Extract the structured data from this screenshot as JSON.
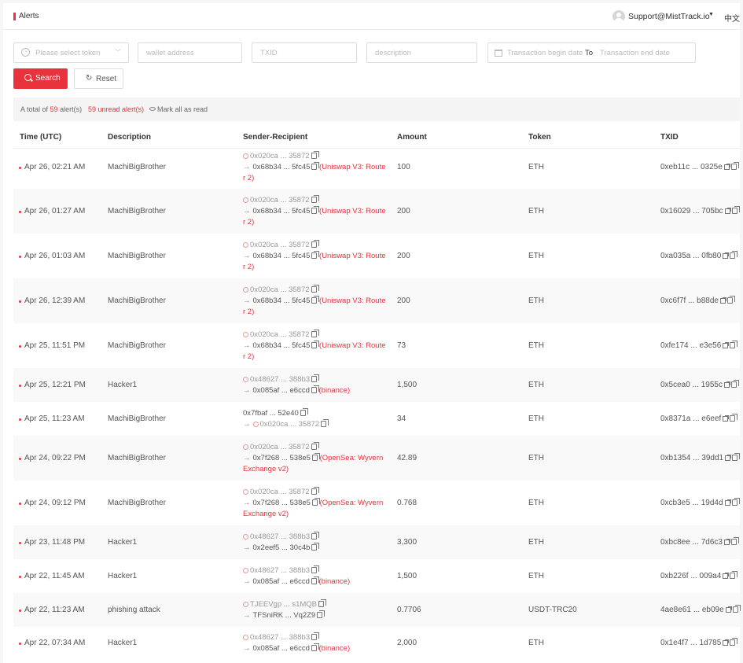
{
  "header": {
    "title": "Alerts",
    "user": "Support@MistTrack.io",
    "language": "中文"
  },
  "filters": {
    "token_placeholder": "Please select token",
    "wallet_placeholder": "wallet address",
    "txid_placeholder": "TXID",
    "description_placeholder": "description",
    "date_begin_placeholder": "Transaction begin date",
    "date_to": "To",
    "date_end_placeholder": "Transaction end date",
    "search_label": "Search",
    "reset_label": "Reset"
  },
  "summary": {
    "total_prefix": "A total of",
    "total_count": "59",
    "total_suffix": "alert(s)",
    "unread_count": "59",
    "unread_suffix": "unread alert(s)",
    "mark_all_label": "Mark all as read"
  },
  "table": {
    "columns": [
      "Time (UTC)",
      "Description",
      "Sender-Recipient",
      "Amount",
      "Token",
      "TXID"
    ],
    "rows": [
      {
        "time": "Apr 26, 02:21 AM",
        "description": "MachiBigBrother",
        "sender": "0x020ca ... 35872",
        "recipient": "0x68b34 ... 5fc45",
        "label_1": "(Uniswap V3: Route",
        "label_2": "r 2)",
        "amount": "100",
        "token": "ETH",
        "txid": "0xeb11c ... 0325e"
      },
      {
        "time": "Apr 26, 01:27 AM",
        "description": "MachiBigBrother",
        "sender": "0x020ca ... 35872",
        "recipient": "0x68b34 ... 5fc45",
        "label_1": "(Uniswap V3: Route",
        "label_2": "r 2)",
        "amount": "200",
        "token": "ETH",
        "txid": "0x16029 ... 705bc"
      },
      {
        "time": "Apr 26, 01:03 AM",
        "description": "MachiBigBrother",
        "sender": "0x020ca ... 35872",
        "recipient": "0x68b34 ... 5fc45",
        "label_1": "(Uniswap V3: Route",
        "label_2": "r 2)",
        "amount": "200",
        "token": "ETH",
        "txid": "0xa035a ... 0fb80"
      },
      {
        "time": "Apr 26, 12:39 AM",
        "description": "MachiBigBrother",
        "sender": "0x020ca ... 35872",
        "recipient": "0x68b34 ... 5fc45",
        "label_1": "(Uniswap V3: Route",
        "label_2": "r 2)",
        "amount": "200",
        "token": "ETH",
        "txid": "0xc6f7f ... b88de"
      },
      {
        "time": "Apr 25, 11:51 PM",
        "description": "MachiBigBrother",
        "sender": "0x020ca ... 35872",
        "recipient": "0x68b34 ... 5fc45",
        "label_1": "(Uniswap V3: Route",
        "label_2": "r 2)",
        "amount": "73",
        "token": "ETH",
        "txid": "0xfe174 ... e3e56"
      },
      {
        "time": "Apr 25, 12:21 PM",
        "description": "Hacker1",
        "sender": "0x48627 ... 388b3",
        "recipient": "0x085af ... e6ccd",
        "label_1": "(binance)",
        "label_2": "",
        "amount": "1,500",
        "token": "ETH",
        "txid": "0x5cea0 ... 1955c"
      },
      {
        "time": "Apr 25, 11:23 AM",
        "description": "MachiBigBrother",
        "sender": "0x7fbaf ... 52e40",
        "recipient": "0x020ca ... 35872",
        "label_1": "",
        "label_2": "",
        "amount": "34",
        "token": "ETH",
        "txid": "0x8371a ... e6eef"
      },
      {
        "time": "Apr 24, 09:22 PM",
        "description": "MachiBigBrother",
        "sender": "0x020ca ... 35872",
        "recipient": "0x7f268 ... 538e5",
        "label_1": "(OpenSea: Wyvern",
        "label_2": "Exchange v2)",
        "amount": "42.89",
        "token": "ETH",
        "txid": "0xb1354 ... 39dd1"
      },
      {
        "time": "Apr 24, 09:12 PM",
        "description": "MachiBigBrother",
        "sender": "0x020ca ... 35872",
        "recipient": "0x7f268 ... 538e5",
        "label_1": "(OpenSea: Wyvern",
        "label_2": "Exchange v2)",
        "amount": "0.768",
        "token": "ETH",
        "txid": "0xcb3e5 ... 19d4d"
      },
      {
        "time": "Apr 23, 11:48 PM",
        "description": "Hacker1",
        "sender": "0x48627 ... 388b3",
        "recipient": "0x2eef5 ... 30c4b",
        "label_1": "",
        "label_2": "",
        "amount": "3,300",
        "token": "ETH",
        "txid": "0xbc8ee ... 7d6c3"
      },
      {
        "time": "Apr 22, 11:45 AM",
        "description": "Hacker1",
        "sender": "0x48627 ... 388b3",
        "recipient": "0x085af ... e6ccd",
        "label_1": "(binance)",
        "label_2": "",
        "amount": "1,500",
        "token": "ETH",
        "txid": "0xb226f ... 009a4"
      },
      {
        "time": "Apr 22, 11:23 AM",
        "description": "phishing attack",
        "sender": "TJEEVgp ... s1MQB",
        "recipient": "TFSniRK ... Vq2Z9",
        "label_1": "",
        "label_2": "",
        "amount": "0.7706",
        "token": "USDT-TRC20",
        "txid": "4ae8e61 ... eb09e"
      },
      {
        "time": "Apr 22, 07:34 AM",
        "description": "Hacker1",
        "sender": "0x48627 ... 388b3",
        "recipient": "0x085af ... e6ccd",
        "label_1": "(binance)",
        "label_2": "",
        "amount": "2,000",
        "token": "ETH",
        "txid": "0x1e4f7 ... 1d785"
      }
    ]
  }
}
